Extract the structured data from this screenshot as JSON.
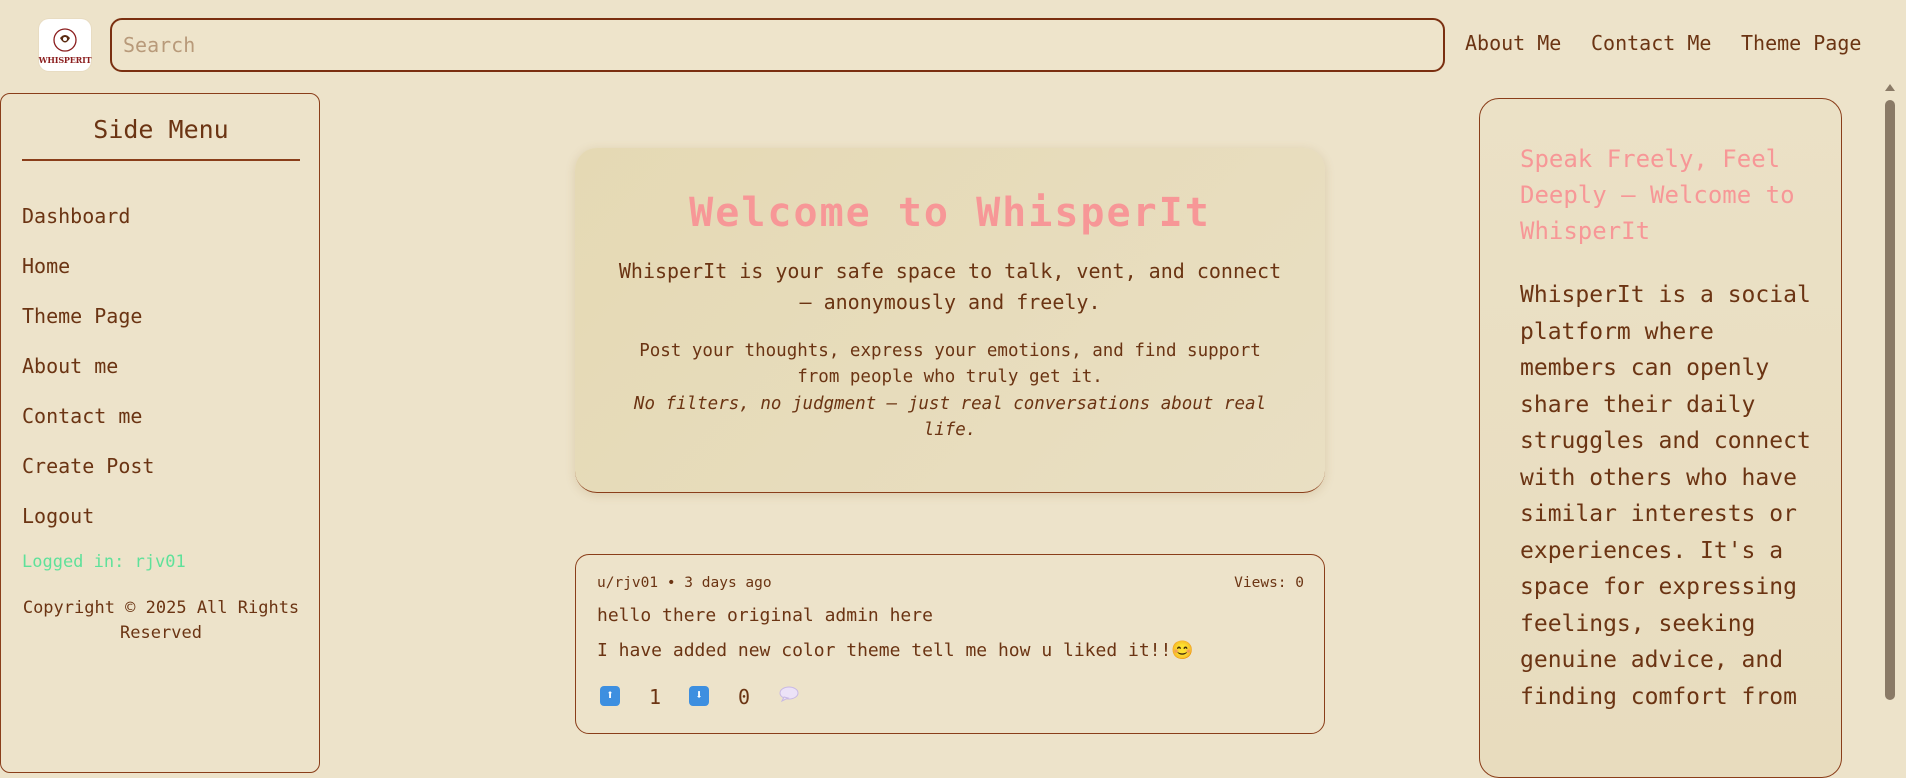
{
  "header": {
    "logo_text": "WHISPERIT",
    "search_placeholder": "Search",
    "nav": [
      "About Me",
      "Contact Me",
      "Theme Page"
    ]
  },
  "sidebar": {
    "title": "Side Menu",
    "items": [
      {
        "label": "Dashboard"
      },
      {
        "label": "Home"
      },
      {
        "label": "Theme Page"
      },
      {
        "label": "About me"
      },
      {
        "label": "Contact me"
      },
      {
        "label": "Create Post"
      },
      {
        "label": "Logout"
      }
    ],
    "logged_in": "Logged in: rjv01",
    "copyright": "Copyright © 2025 All Rights Reserved"
  },
  "welcome": {
    "title": "Welcome to WhisperIt",
    "subtitle": "WhisperIt is your safe space to talk, vent, and connect — anonymously and freely.",
    "paragraph": "Post your thoughts, express your emotions, and find support from people who truly get it.",
    "emphasis": "No filters, no judgment — just real conversations about real life."
  },
  "post": {
    "meta": "u/rjv01 • 3 days ago",
    "views": "Views: 0",
    "title": "hello there original admin here",
    "body": "I have added new color theme tell me how u liked it!!😊",
    "upvote_icon": "⬆",
    "upvotes": "1",
    "downvote_icon": "⬇",
    "downvotes": "0",
    "comment_icon": "speech-bubble"
  },
  "aside": {
    "title": "Speak Freely, Feel Deeply — Welcome to WhisperIt",
    "body": "WhisperIt is a social platform where members can openly share their daily struggles and connect with others who have similar interests or experiences. It's a space for expressing feelings, seeking genuine advice, and finding comfort from"
  },
  "colors": {
    "background": "#ede3ca",
    "text": "#6b3413",
    "accent_pink": "#f79797",
    "logged_in_green": "#5fe19a",
    "vote_blue": "#3d8fe0"
  }
}
